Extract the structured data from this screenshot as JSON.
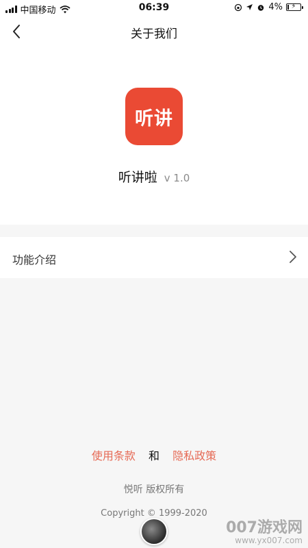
{
  "status_bar": {
    "carrier": "中国移动",
    "time": "06:39",
    "battery": "4%",
    "battery_level": 0.04
  },
  "navbar": {
    "title": "关于我们",
    "back_icon": "chevron-left-icon"
  },
  "app": {
    "icon_text": "听讲",
    "icon_color": "#ea4a34",
    "name": "听讲啦",
    "version": "v 1.0"
  },
  "menu": {
    "feature_label": "功能介绍",
    "chevron_icon": "chevron-right-icon"
  },
  "footer": {
    "terms": "使用条款",
    "and": "和",
    "privacy": "隐私政策",
    "owner": "悦听 版权所有",
    "copyright": "Copyright © 1999-2020",
    "link_color": "#e66a55"
  },
  "watermark": {
    "line1": "007游戏网",
    "line2": "www.yx007.com"
  }
}
